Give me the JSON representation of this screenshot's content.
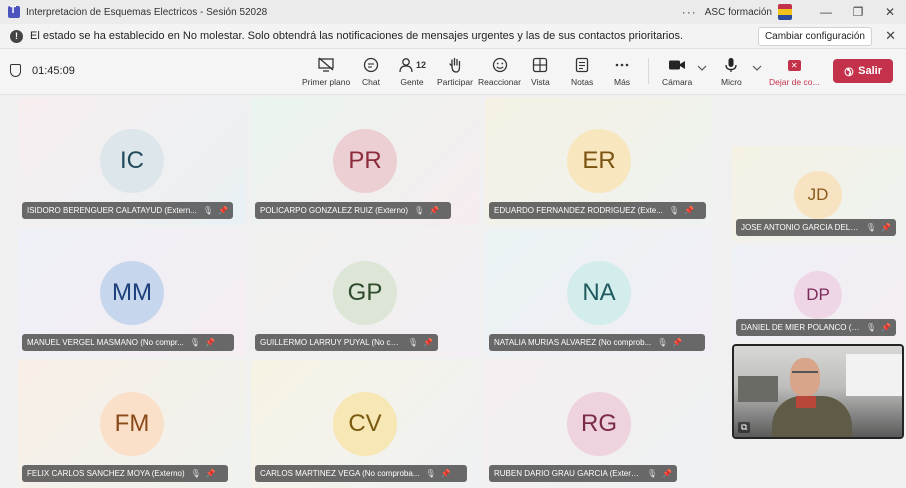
{
  "window": {
    "title": "Interpretacion de Esquemas Electricos - Sesión 52028",
    "more": "···",
    "org": "ASC formación",
    "controls": {
      "minimize": "—",
      "restore": "❐",
      "close": "✕"
    }
  },
  "notification": {
    "icon": "!",
    "text": "El estado se ha establecido en No molestar. Solo obtendrá las notificaciones de mensajes urgentes y las de sus contactos prioritarios.",
    "button": "Cambiar configuración",
    "close": "✕"
  },
  "toolbar": {
    "timer": "01:45:09",
    "items": {
      "primer_plano": "Primer plano",
      "chat": "Chat",
      "gente": "Gente",
      "gente_count": "12",
      "participar": "Participar",
      "reaccionar": "Reaccionar",
      "vista": "Vista",
      "notas": "Notas",
      "mas": "Más",
      "camara": "Cámara",
      "micro": "Micro",
      "dejar": "Dejar de co..."
    },
    "exit": "Salir"
  },
  "participants": [
    {
      "initials": "IC",
      "name": "ISIDORO BERENGUER CALATAYUD (Extern...",
      "bg": "#dde6ea",
      "fg": "#1f4a5a"
    },
    {
      "initials": "PR",
      "name": "POLICARPO GONZALEZ RUIZ (Externo)",
      "bg": "#eccfd2",
      "fg": "#8c2b3b"
    },
    {
      "initials": "ER",
      "name": "EDUARDO FERNANDEZ RODRIGUEZ (Exte...",
      "bg": "#f8e6bf",
      "fg": "#7a5410"
    },
    {
      "initials": "MM",
      "name": "MANUEL VERGEL MASMANO (No compr...",
      "bg": "#c6d6ec",
      "fg": "#1d3f7a"
    },
    {
      "initials": "GP",
      "name": "GUILLERMO LARRUY PUYAL (No comprob...",
      "bg": "#dde5d6",
      "fg": "#2e4a2a"
    },
    {
      "initials": "NA",
      "name": "NATALIA MURIAS ALVAREZ (No comprob...",
      "bg": "#d3ecec",
      "fg": "#1e5a5c"
    },
    {
      "initials": "FM",
      "name": "FELIX CARLOS SANCHEZ MOYA (Externo)",
      "bg": "#fae0c8",
      "fg": "#8a4a1a"
    },
    {
      "initials": "CV",
      "name": "CARLOS MARTINEZ VEGA (No comproba...",
      "bg": "#f7e7b4",
      "fg": "#7a5a10"
    },
    {
      "initials": "RG",
      "name": "RUBEN DARIO GRAU GARCIA (Externo)",
      "bg": "#eed3de",
      "fg": "#7a2b4a"
    }
  ],
  "side_participants": [
    {
      "initials": "JD",
      "name": "JOSE ANTONIO GARCIA DELGA...",
      "bg": "#f7e3c1",
      "fg": "#8a5a1a"
    },
    {
      "initials": "DP",
      "name": "DANIEL DE MIER POLANCO (N...",
      "bg": "#efd6e6",
      "fg": "#7a2b5a"
    }
  ],
  "icons": {
    "mic_off": "🎙",
    "pin": "📌"
  },
  "self_video": {
    "indicator": "⧉"
  }
}
